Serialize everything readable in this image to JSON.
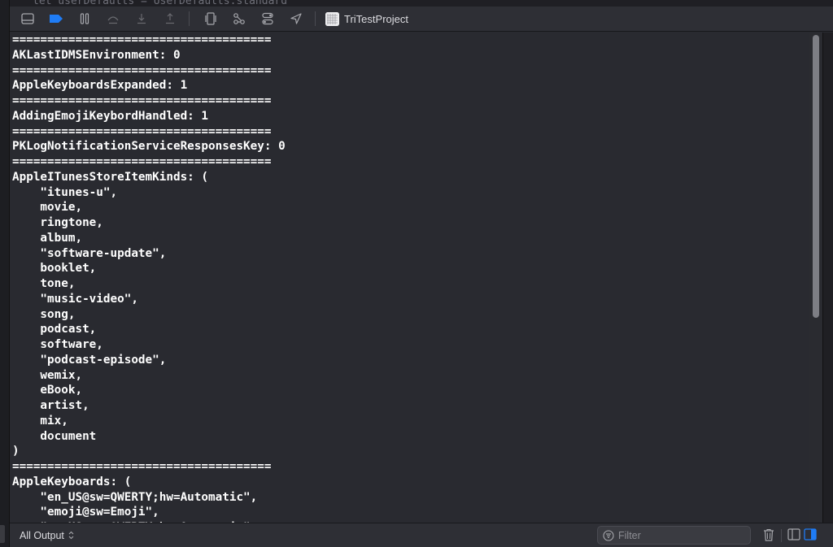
{
  "editor_peek": "let userDefaults = UserDefaults.standard",
  "toolbar": {
    "project_name": "TriTestProject",
    "icons": [
      "hide-debug-area-icon",
      "breakpoints-icon",
      "pause-icon",
      "step-over-icon",
      "step-into-icon",
      "step-out-icon",
      "view-hierarchy-icon",
      "memory-graph-icon",
      "environment-overrides-icon",
      "simulate-location-icon"
    ]
  },
  "console": {
    "lines": [
      "=====================================",
      "AKLastIDMSEnvironment: 0",
      "=====================================",
      "AppleKeyboardsExpanded: 1",
      "=====================================",
      "AddingEmojiKeybordHandled: 1",
      "=====================================",
      "PKLogNotificationServiceResponsesKey: 0",
      "=====================================",
      "AppleITunesStoreItemKinds: (",
      "    \"itunes-u\",",
      "    movie,",
      "    ringtone,",
      "    album,",
      "    \"software-update\",",
      "    booklet,",
      "    tone,",
      "    \"music-video\",",
      "    song,",
      "    podcast,",
      "    software,",
      "    \"podcast-episode\",",
      "    wemix,",
      "    eBook,",
      "    artist,",
      "    mix,",
      "    document",
      ")",
      "=====================================",
      "AppleKeyboards: (",
      "    \"en_US@sw=QWERTY;hw=Automatic\",",
      "    \"emoji@sw=Emoji\",",
      "    \"en_US@sw=QWERTY;hw=Automatic\""
    ]
  },
  "bottombar": {
    "scope_label": "All Output",
    "scope_chevron": "⌃⌄",
    "filter_placeholder": "Filter"
  },
  "colors": {
    "accent": "#1f7cf5",
    "console_bg": "#292a30",
    "text": "#ffffff"
  }
}
